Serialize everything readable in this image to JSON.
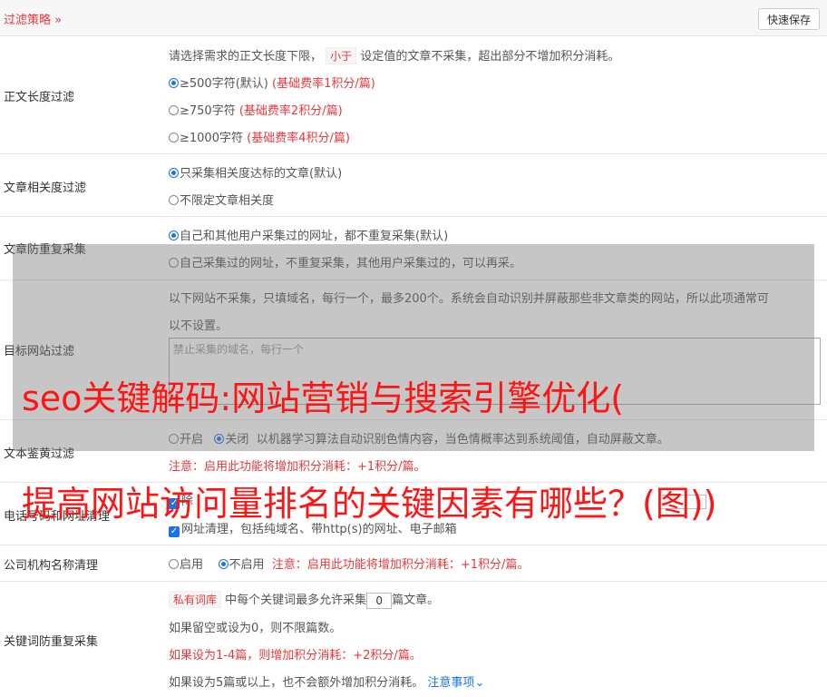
{
  "header": {
    "title": "过滤策略",
    "save_label": "快速保存"
  },
  "rows": {
    "length": {
      "label": "正文长度过滤",
      "desc_a": "请选择需求的正文长度下限，",
      "desc_tag": "小于",
      "desc_b": "设定值的文章不采集，超出部分不增加积分消耗。",
      "options": [
        {
          "label": "≥500字符(默认)",
          "fee": "(基础费率1积分/篇)"
        },
        {
          "label": "≥750字符",
          "fee": "(基础费率2积分/篇)"
        },
        {
          "label": "≥1000字符",
          "fee": "(基础费率4积分/篇)"
        }
      ]
    },
    "relevance": {
      "label": "文章相关度过滤",
      "options": [
        "只采集相关度达标的文章(默认)",
        "不限定文章相关度"
      ]
    },
    "dedup": {
      "label": "文章防重复采集",
      "options": [
        "自己和其他用户采集过的网址，都不重复采集(默认)",
        "自己采集过的网址，不重复采集，其他用户采集过的，可以再采。"
      ]
    },
    "target": {
      "label": "目标网站过滤",
      "desc_1": "以下网站不采集，只填域名，每行一个，最多200个。系统会自动识别并屏蔽那些非文章类的网站，所以此项通常可",
      "desc_2": "以不设置。",
      "placeholder": "禁止采集的域名，每行一个"
    },
    "porn": {
      "label": "文本鉴黄过滤",
      "opt_on": "开启",
      "opt_off": "关闭",
      "desc": "以机器学习算法自动识别色情内容，当色情概率达到系统阈值，自动屏蔽文章。",
      "warning": "注意：启用此功能将增加积分消耗：+1积分/篇。"
    },
    "phone": {
      "label": "电话号码和网址清理",
      "partial": "除",
      "url_option": "网址清理，包括纯域名、带http(s)的网址、电子邮箱"
    },
    "company": {
      "label": "公司机构名称清理",
      "opt_on": "启用",
      "opt_off": "不启用",
      "warning": "注意：启用此功能将增加积分消耗：+1积分/篇。"
    },
    "keyword": {
      "label": "关键词防重复采集",
      "tag": "私有词库",
      "line1_a": "中每个关键词最多允许采集",
      "value": "0",
      "line1_b": "篇文章。",
      "line2": "如果留空或设为0，则不限篇数。",
      "line3": "如果设为1-4篇，则增加积分消耗：+2积分/篇。",
      "line4": "如果设为5篇或以上，也不会额外增加积分消耗。",
      "note": "注意事项"
    }
  },
  "overlay": {
    "line1": "seo关键解码:网站营销与搜索引擎优化(",
    "line2": "提高网站访问量排名的关键因素有哪些？(图))"
  }
}
